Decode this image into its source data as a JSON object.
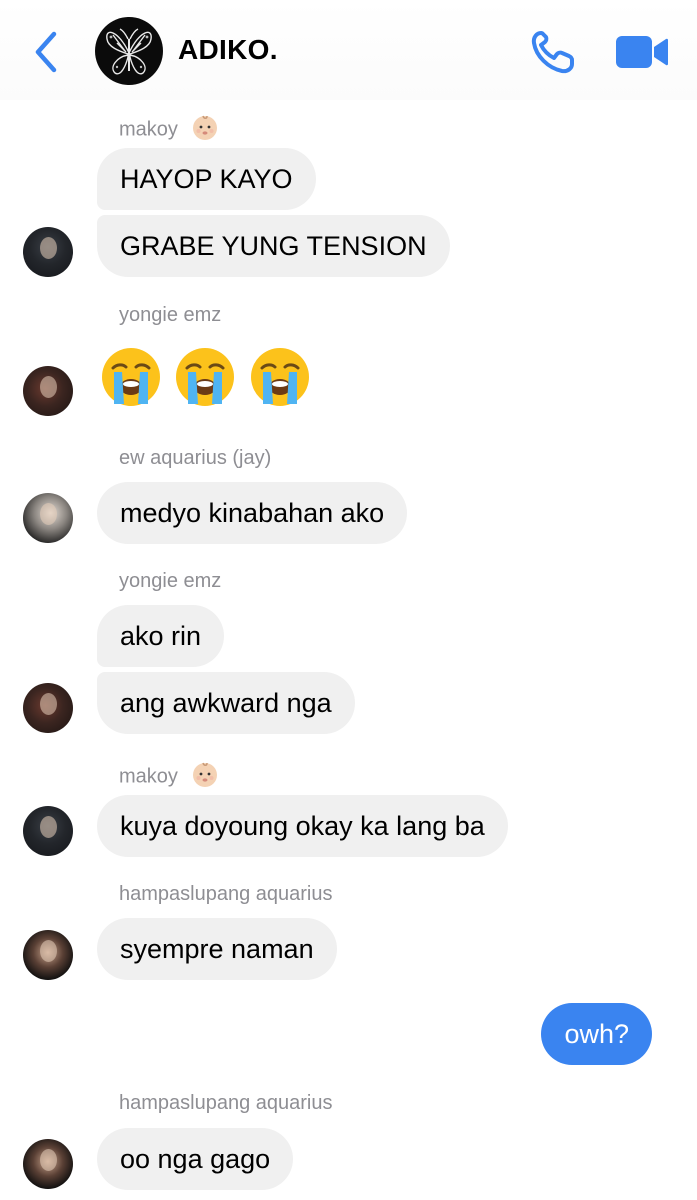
{
  "header": {
    "group_name": "ADIKO.",
    "back_icon": "chevron-left-icon",
    "call_icon": "phone-icon",
    "video_icon": "video-camera-icon",
    "accent_color": "#3a84f0"
  },
  "messages": [
    {
      "sender": "makoy",
      "sender_emoji": "baby-face-emoji",
      "bubbles": [
        "HAYOP KAYO",
        "GRABE YUNG TENSION"
      ]
    },
    {
      "sender": "yongie emz",
      "emojis": [
        "loudly-crying-face-emoji",
        "loudly-crying-face-emoji",
        "loudly-crying-face-emoji"
      ]
    },
    {
      "sender": "ew aquarius (jay)",
      "bubbles": [
        "medyo kinabahan ako"
      ]
    },
    {
      "sender": "yongie emz",
      "bubbles": [
        "ako rin",
        "ang awkward nga"
      ]
    },
    {
      "sender": "makoy",
      "sender_emoji": "baby-face-emoji",
      "bubbles": [
        "kuya doyoung okay ka lang ba"
      ]
    },
    {
      "sender": "hampaslupang aquarius",
      "bubbles": [
        "syempre naman"
      ]
    },
    {
      "sender": "me",
      "outgoing": true,
      "bubbles": [
        "owh?"
      ]
    },
    {
      "sender": "hampaslupang aquarius",
      "bubbles": [
        "oo nga gago"
      ]
    }
  ],
  "colors": {
    "incoming_bubble": "#f0f0f0",
    "outgoing_bubble": "#3a84f0",
    "sender_name": "#8e8e93"
  }
}
